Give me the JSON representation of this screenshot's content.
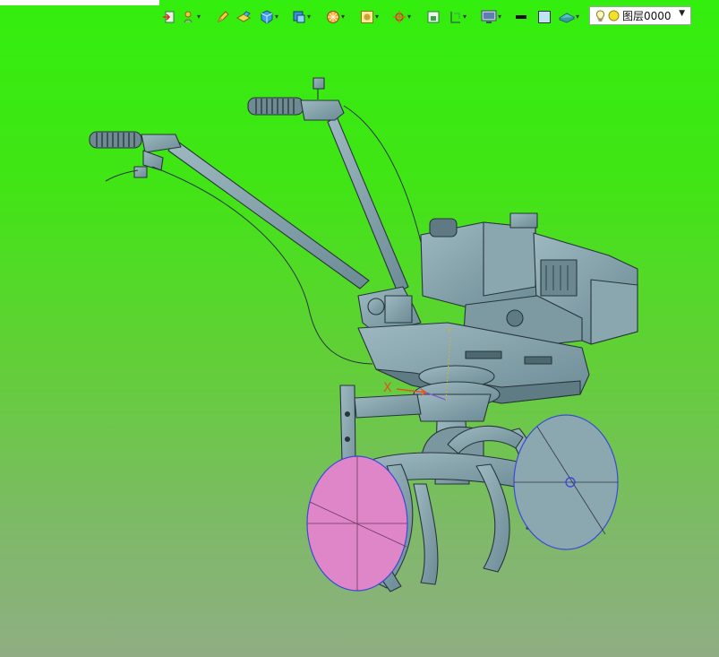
{
  "toolbar": {
    "tools": [
      {
        "name": "exit-sketch-icon",
        "has_menu": false
      },
      {
        "name": "snap-icon",
        "has_menu": true
      },
      {
        "name": "pencil-icon",
        "has_menu": false
      },
      {
        "name": "extrude-icon",
        "has_menu": false
      },
      {
        "name": "cube-icon",
        "has_menu": true
      },
      {
        "name": "view-cube-icon",
        "has_menu": true
      },
      {
        "name": "section-icon",
        "has_menu": true
      },
      {
        "name": "render-mode-icon",
        "has_menu": true
      },
      {
        "name": "move-axis-icon",
        "has_menu": true
      },
      {
        "name": "fit-view-icon",
        "has_menu": false
      },
      {
        "name": "measure-icon",
        "has_menu": true
      },
      {
        "name": "display-icon",
        "has_menu": true
      },
      {
        "name": "line-color-icon",
        "has_menu": false
      },
      {
        "name": "fill-color-icon",
        "has_menu": false
      },
      {
        "name": "material-icon",
        "has_menu": true
      }
    ],
    "layer": {
      "value": "图层0000",
      "icons": [
        "lightbulb-icon",
        "sun-icon"
      ]
    }
  },
  "viewport": {
    "axis_x_label": "X",
    "axis_y_label": "Y",
    "colors": {
      "model": "#7f9ea8",
      "model_dark": "#5d7a84",
      "edge": "#27363b",
      "highlight_disc": "#de86c8",
      "selection_edge": "#3b49d8"
    }
  }
}
